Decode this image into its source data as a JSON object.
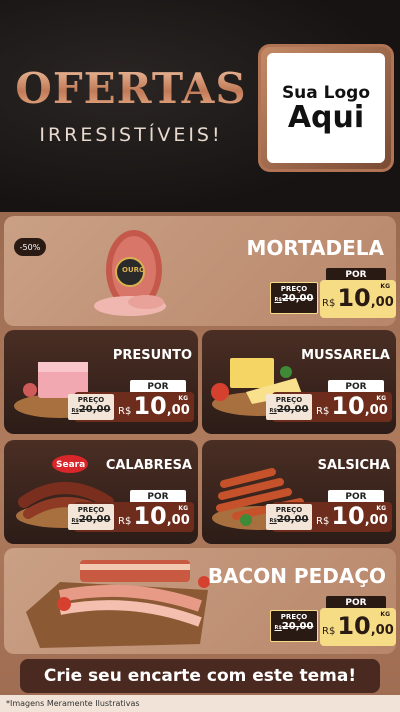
{
  "hero": {
    "title": "OFERTAS",
    "subtitle": "IRRESISTÍVEIS!",
    "logo_line1": "Sua Logo",
    "logo_line2": "Aqui"
  },
  "price_labels": {
    "preco": "PREÇO",
    "por": "POR",
    "old_prefix": "R$",
    "old_value": "20,00",
    "currency": "R$",
    "new_int": "10",
    "new_dec": ",00",
    "unit": "KG"
  },
  "products": [
    {
      "name": "MORTADELA",
      "discount": "-50%"
    },
    {
      "name": "PRESUNTO"
    },
    {
      "name": "MUSSARELA"
    },
    {
      "name": "CALABRESA",
      "brand": "Seara"
    },
    {
      "name": "SALSICHA"
    },
    {
      "name": "BACON PEDAÇO"
    }
  ],
  "mortadela_brand": "OURO",
  "cta": "Crie seu encarte com este tema!",
  "footnote": "*Imagens Meramente Ilustrativas",
  "colors": {
    "accent_copper": "#c07a57",
    "price_dark": "#6e2d1c",
    "price_gold": "#f7dc86",
    "card_dark": "#2c1c17"
  }
}
